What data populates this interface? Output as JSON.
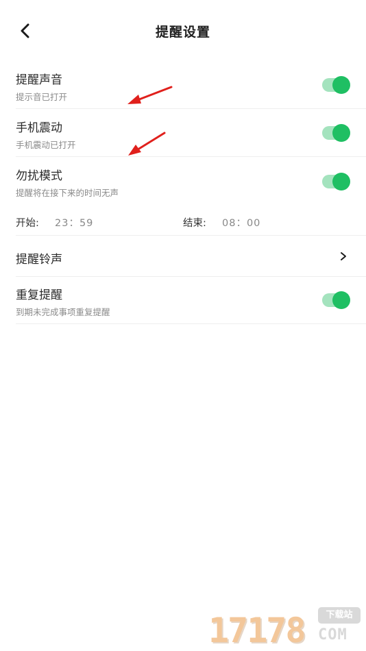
{
  "header": {
    "title": "提醒设置",
    "back_icon": "chevron-left-icon"
  },
  "settings": {
    "sound": {
      "title": "提醒声音",
      "subtitle": "提示音已打开",
      "enabled": true
    },
    "vibration": {
      "title": "手机震动",
      "subtitle": "手机震动已打开",
      "enabled": true
    },
    "dnd": {
      "title": "勿扰模式",
      "subtitle": "提醒将在接下来的时间无声",
      "enabled": true
    },
    "dnd_time": {
      "start_label": "开始:",
      "start_value": "23：59",
      "end_label": "结束:",
      "end_value": "08：00"
    },
    "ringtone": {
      "title": "提醒铃声",
      "icon": "chevron-right-icon"
    },
    "repeat": {
      "title": "重复提醒",
      "subtitle": "到期未完成事项重复提醒",
      "enabled": true
    }
  },
  "colors": {
    "toggle_on": "#1fbf63",
    "toggle_track": "#a4e3be",
    "annotation_arrow": "#e0201c"
  },
  "watermark": {
    "digits": "17178",
    "badge": "下载站",
    "domain": "COM"
  }
}
